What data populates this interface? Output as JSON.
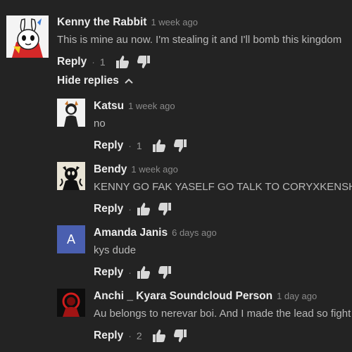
{
  "comments": [
    {
      "author": "Kenny the Rabbit",
      "time": "1 week ago",
      "text": "This is mine au now. I'm stealing it and I'll bomb this kingdom",
      "reply_label": "Reply",
      "like_count": "1",
      "avatar_icon": "white-rabbit-avatar"
    }
  ],
  "hide_replies_label": "Hide replies",
  "replies": [
    {
      "author": "Katsu",
      "time": "1 week ago",
      "text": "no",
      "reply_label": "Reply",
      "like_count": "1",
      "avatar_icon": "sketch-character-avatar"
    },
    {
      "author": "Bendy",
      "time": "1 week ago",
      "text": "KENNY GO FAK YASELF GO TALK TO CORYXKENSHIN",
      "reply_label": "Reply",
      "like_count": "",
      "avatar_icon": "ink-character-avatar"
    },
    {
      "author": "Amanda Janis",
      "time": "6 days ago",
      "text": "kys dude",
      "reply_label": "Reply",
      "like_count": "",
      "avatar_letter": "A",
      "avatar_color": "#4a5fb0"
    },
    {
      "author": "Anchi _ Kyara Soundcloud Person",
      "time": "1 day ago",
      "text": "Au belongs to nerevar boi. And I made the lead so fight me",
      "reply_label": "Reply",
      "like_count": "2",
      "avatar_icon": "red-glow-character-avatar"
    }
  ]
}
